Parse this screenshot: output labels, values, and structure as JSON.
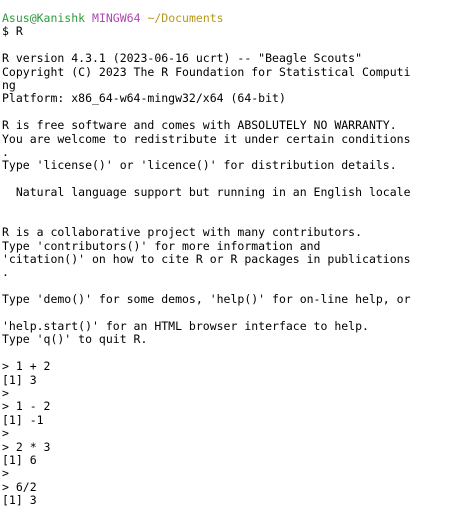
{
  "prompt": {
    "user": "Asus@Kanishk",
    "system": "MINGW64",
    "path": "~/Documents",
    "command": "$ R"
  },
  "output_lines": [
    "",
    "R version 4.3.1 (2023-06-16 ucrt) -- \"Beagle Scouts\"",
    "Copyright (C) 2023 The R Foundation for Statistical Computi",
    "ng",
    "Platform: x86_64-w64-mingw32/x64 (64-bit)",
    "",
    "R is free software and comes with ABSOLUTELY NO WARRANTY.",
    "You are welcome to redistribute it under certain conditions",
    ".",
    "Type 'license()' or 'licence()' for distribution details.",
    "",
    "  Natural language support but running in an English locale",
    "",
    "",
    "R is a collaborative project with many contributors.",
    "Type 'contributors()' for more information and",
    "'citation()' on how to cite R or R packages in publications",
    ".",
    "",
    "Type 'demo()' for some demos, 'help()' for on-line help, or",
    "",
    "'help.start()' for an HTML browser interface to help.",
    "Type 'q()' to quit R.",
    "",
    "> 1 + 2",
    "[1] 3",
    ">",
    "> 1 - 2",
    "[1] -1",
    ">",
    "> 2 * 3",
    "[1] 6",
    ">",
    "> 6/2",
    "[1] 3"
  ],
  "colors": {
    "user": "#2a9d3a",
    "system": "#b046b0",
    "path": "#b89a1a",
    "text": "#000000",
    "background": "#ffffff"
  }
}
